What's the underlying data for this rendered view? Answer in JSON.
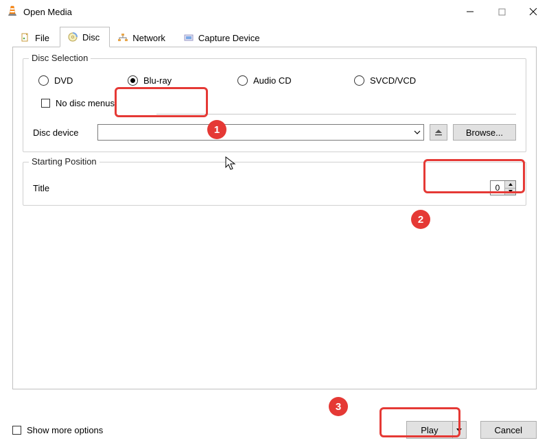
{
  "title": "Open Media",
  "tabs": [
    {
      "label": "File"
    },
    {
      "label": "Disc"
    },
    {
      "label": "Network"
    },
    {
      "label": "Capture Device"
    }
  ],
  "disc_selection": {
    "legend": "Disc Selection",
    "radios": {
      "dvd": "DVD",
      "bluray": "Blu-ray",
      "audiocd": "Audio CD",
      "svcd": "SVCD/VCD"
    },
    "no_menus": "No disc menus",
    "device_label": "Disc device",
    "device_value": "",
    "browse": "Browse..."
  },
  "starting_position": {
    "legend": "Starting Position",
    "title_label": "Title",
    "title_value": "0"
  },
  "bottom": {
    "show_more": "Show more options",
    "play": "Play",
    "cancel": "Cancel"
  },
  "badges": {
    "1": "1",
    "2": "2",
    "3": "3"
  }
}
